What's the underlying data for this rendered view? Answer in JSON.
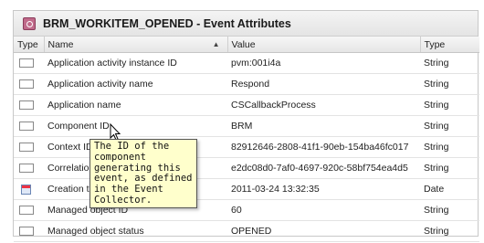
{
  "panel": {
    "title": "BRM_WORKITEM_OPENED - Event Attributes"
  },
  "table": {
    "headers": [
      "Type",
      "Name",
      "Value",
      "Type"
    ],
    "rows": [
      {
        "icon": "text-type-icon",
        "name": "Application activity instance ID",
        "value": "pvm:001i4a",
        "type": "String"
      },
      {
        "icon": "text-type-icon",
        "name": "Application activity name",
        "value": "Respond",
        "type": "String"
      },
      {
        "icon": "text-type-icon",
        "name": "Application name",
        "value": "CSCallbackProcess",
        "type": "String"
      },
      {
        "icon": "text-type-icon",
        "name": "Component ID",
        "value": "BRM",
        "type": "String"
      },
      {
        "icon": "text-type-icon",
        "name": "Context ID",
        "value": "82912646-2808-41f1-90eb-154ba46fc017",
        "type": "String"
      },
      {
        "icon": "text-type-icon",
        "name": "Correlation ID",
        "value": "e2dc08d0-7af0-4697-920c-58bf754ea4d5",
        "type": "String"
      },
      {
        "icon": "date-type-icon",
        "name": "Creation time",
        "value": "2011-03-24 13:32:35",
        "type": "Date"
      },
      {
        "icon": "text-type-icon",
        "name": "Managed object ID",
        "value": "60",
        "type": "String"
      },
      {
        "icon": "text-type-icon",
        "name": "Managed object status",
        "value": "OPENED",
        "type": "String"
      }
    ]
  },
  "tooltip": {
    "text": "The ID of the\ncomponent\ngenerating this\nevent, as defined\nin the Event\nCollector."
  }
}
